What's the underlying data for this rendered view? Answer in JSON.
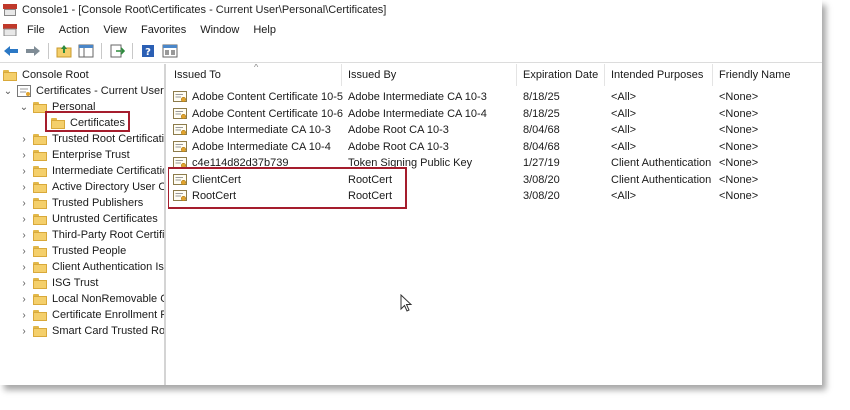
{
  "window": {
    "title": "Console1 - [Console Root\\Certificates - Current User\\Personal\\Certificates]"
  },
  "menu": [
    "File",
    "Action",
    "View",
    "Favorites",
    "Window",
    "Help"
  ],
  "toolbar_icons": [
    "back-arrow-icon",
    "forward-arrow-icon",
    "up-folder-icon",
    "show-hide-tree-icon",
    "export-list-icon",
    "help-icon",
    "properties-icon"
  ],
  "tree": {
    "root": "Console Root",
    "store": "Certificates - Current User",
    "personal": "Personal",
    "certificates": "Certificates",
    "folders": [
      "Trusted Root Certification Authorities",
      "Enterprise Trust",
      "Intermediate Certification Authorities",
      "Active Directory User Object",
      "Trusted Publishers",
      "Untrusted Certificates",
      "Third-Party Root Certification Authorities",
      "Trusted People",
      "Client Authentication Issuers",
      "ISG Trust",
      "Local NonRemovable Certificates",
      "Certificate Enrollment Requests",
      "Smart Card Trusted Roots"
    ]
  },
  "columns": [
    "Issued To",
    "Issued By",
    "Expiration Date",
    "Intended Purposes",
    "Friendly Name"
  ],
  "rows": [
    [
      "Adobe Content Certificate 10-5",
      "Adobe Intermediate CA 10-3",
      "8/18/25",
      "<All>",
      "<None>"
    ],
    [
      "Adobe Content Certificate 10-6",
      "Adobe Intermediate CA 10-4",
      "8/18/25",
      "<All>",
      "<None>"
    ],
    [
      "Adobe Intermediate CA 10-3",
      "Adobe Root CA 10-3",
      "8/04/68",
      "<All>",
      "<None>"
    ],
    [
      "Adobe Intermediate CA 10-4",
      "Adobe Root CA 10-3",
      "8/04/68",
      "<All>",
      "<None>"
    ],
    [
      "c4e114d82d37b739",
      "Token Signing Public Key",
      "1/27/19",
      "Client Authentication",
      "<None>"
    ],
    [
      "ClientCert",
      "RootCert",
      "3/08/20",
      "Client Authentication",
      "<None>"
    ],
    [
      "RootCert",
      "RootCert",
      "3/08/20",
      "<All>",
      "<None>"
    ]
  ],
  "colors": {
    "highlight": "#a51d2d",
    "folder": "#f4cf6b"
  }
}
